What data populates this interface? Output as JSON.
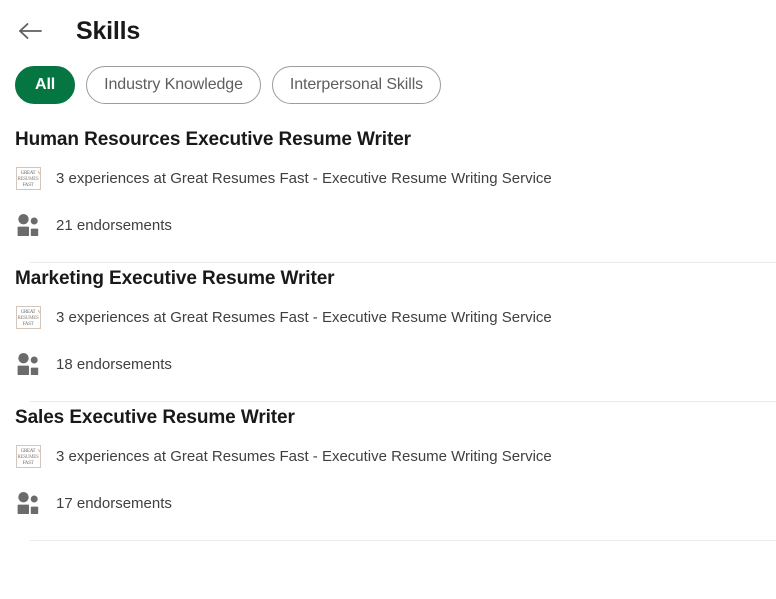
{
  "header": {
    "back_icon": "back-arrow-icon",
    "title": "Skills"
  },
  "filters": {
    "items": [
      {
        "label": "All",
        "selected": true
      },
      {
        "label": "Industry Knowledge",
        "selected": false
      },
      {
        "label": "Interpersonal Skills",
        "selected": false
      }
    ]
  },
  "colors": {
    "accent_green": "#057642",
    "text_primary": "#191919",
    "text_secondary": "#404040",
    "pill_border": "#9c9c9c",
    "divider": "#ebebeb"
  },
  "logo": {
    "line1": "GREAT",
    "line2": "RESUMES",
    "line3": "FAST"
  },
  "skills": [
    {
      "name": "Human Resources Executive Resume Writer",
      "experience_icon": "company-logo-icon",
      "experience_text": "3 experiences at Great Resumes Fast - Executive Resume Writing Service",
      "endorsement_icon": "people-icon",
      "endorsement_text": "21 endorsements"
    },
    {
      "name": "Marketing Executive Resume Writer",
      "experience_icon": "company-logo-icon",
      "experience_text": "3 experiences at Great Resumes Fast - Executive Resume Writing Service",
      "endorsement_icon": "people-icon",
      "endorsement_text": "18 endorsements"
    },
    {
      "name": "Sales Executive Resume Writer",
      "experience_icon": "company-logo-icon",
      "experience_text": "3 experiences at Great Resumes Fast - Executive Resume Writing Service",
      "endorsement_icon": "people-icon",
      "endorsement_text": "17 endorsements"
    }
  ]
}
